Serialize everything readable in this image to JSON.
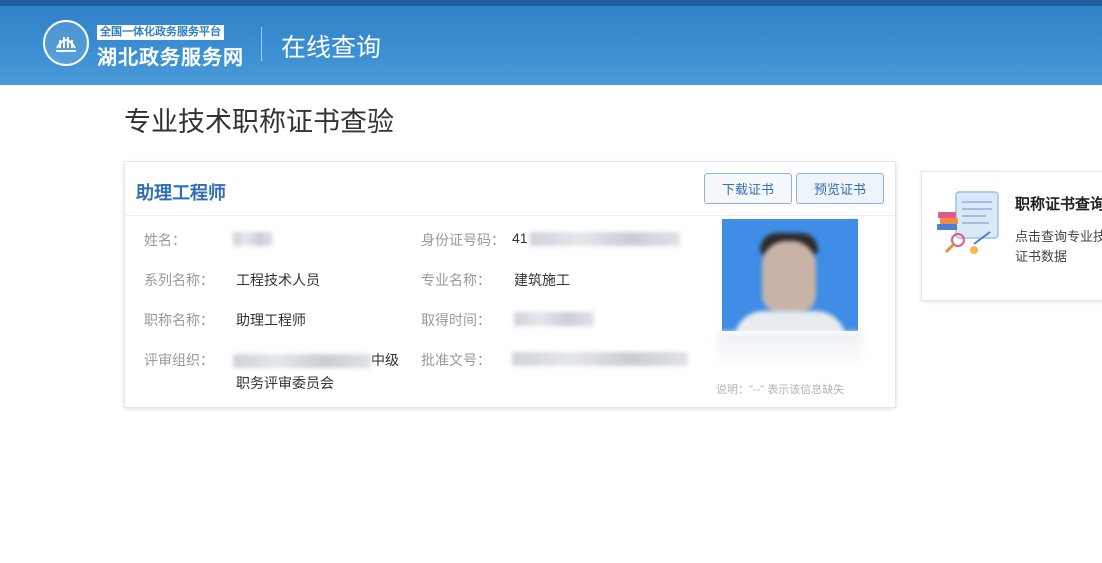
{
  "header": {
    "logo_icon": "govt-service-logo-icon",
    "logo_tag": "全国一体化政务服务平台",
    "logo_name": "湖北政务服务网",
    "section_title": "在线查询"
  },
  "page": {
    "title": "专业技术职称证书查验"
  },
  "certificate": {
    "title": "助理工程师",
    "download_label": "下载证书",
    "preview_label": "预览证书",
    "fields": {
      "name_label": "姓名：",
      "id_label": "身份证号码：",
      "id_prefix": "41",
      "series_label": "系列名称：",
      "series_value": "工程技术人员",
      "major_label": "专业名称：",
      "major_value": "建筑施工",
      "title_label": "职称名称：",
      "title_value": "助理工程师",
      "obtained_label": "取得时间：",
      "org_label": "评审组织：",
      "org_suffix": "中级",
      "org_line2": "职务评审委员会",
      "approval_label": "批准文号："
    },
    "note": "说明：\"--\" 表示该信息缺失",
    "photo_icon": "id-photo"
  },
  "side_card": {
    "illustration_icon": "certificate-query-illustration-icon",
    "title": "职称证书查询",
    "desc_line1": "点击查询专业技",
    "desc_line2": "证书数据"
  },
  "colors": {
    "header_blue": "#3b8fd3",
    "title_blue": "#2f6fb4",
    "photo_blue": "#3f8de6"
  }
}
